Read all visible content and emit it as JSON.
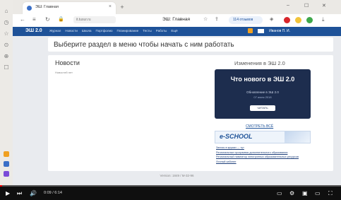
{
  "browser": {
    "tab_title": "ЭШ: Главная",
    "new_tab": "+",
    "url": "it.tusur.ru",
    "page_title": "ЭШ: Главная",
    "reviews": "114 отзывов",
    "win_min": "–",
    "win_max": "☐",
    "win_close": "✕"
  },
  "site": {
    "logo": "ЭШ 2.0",
    "menu": [
      "Журнал",
      "Новости",
      "Школа",
      "Портфолио",
      "Планирование",
      "Тесты",
      "Работы",
      "Ещё"
    ],
    "user": "Иванов П. И."
  },
  "page": {
    "heading": "Выберите раздел в меню чтобы начать с ним работать",
    "news_title": "Новости",
    "news_empty": "Новостей нет",
    "changes_title": "Изменения в ЭШ 2.0",
    "banner_title": "Что нового в ЭШ 2.0",
    "banner_sub": "Обновление в ЭШ 2.0",
    "banner_date": "07 июня 2018",
    "banner_button": "ЧИТАТЬ",
    "all_link": "СМОТРЕТЬ ВСЁ",
    "eschool_logo": "e-SCHOOL",
    "links": [
      "Запись в кружки — тут",
      "Региональные программы дополнительного образования",
      "Региональный навигатор электронных образовательных ресурсов",
      "Личный кабинет"
    ],
    "footer": "Version: 1849 / M-32-96"
  },
  "video": {
    "time": "0:09 / 6:14",
    "progress": 0.006
  }
}
